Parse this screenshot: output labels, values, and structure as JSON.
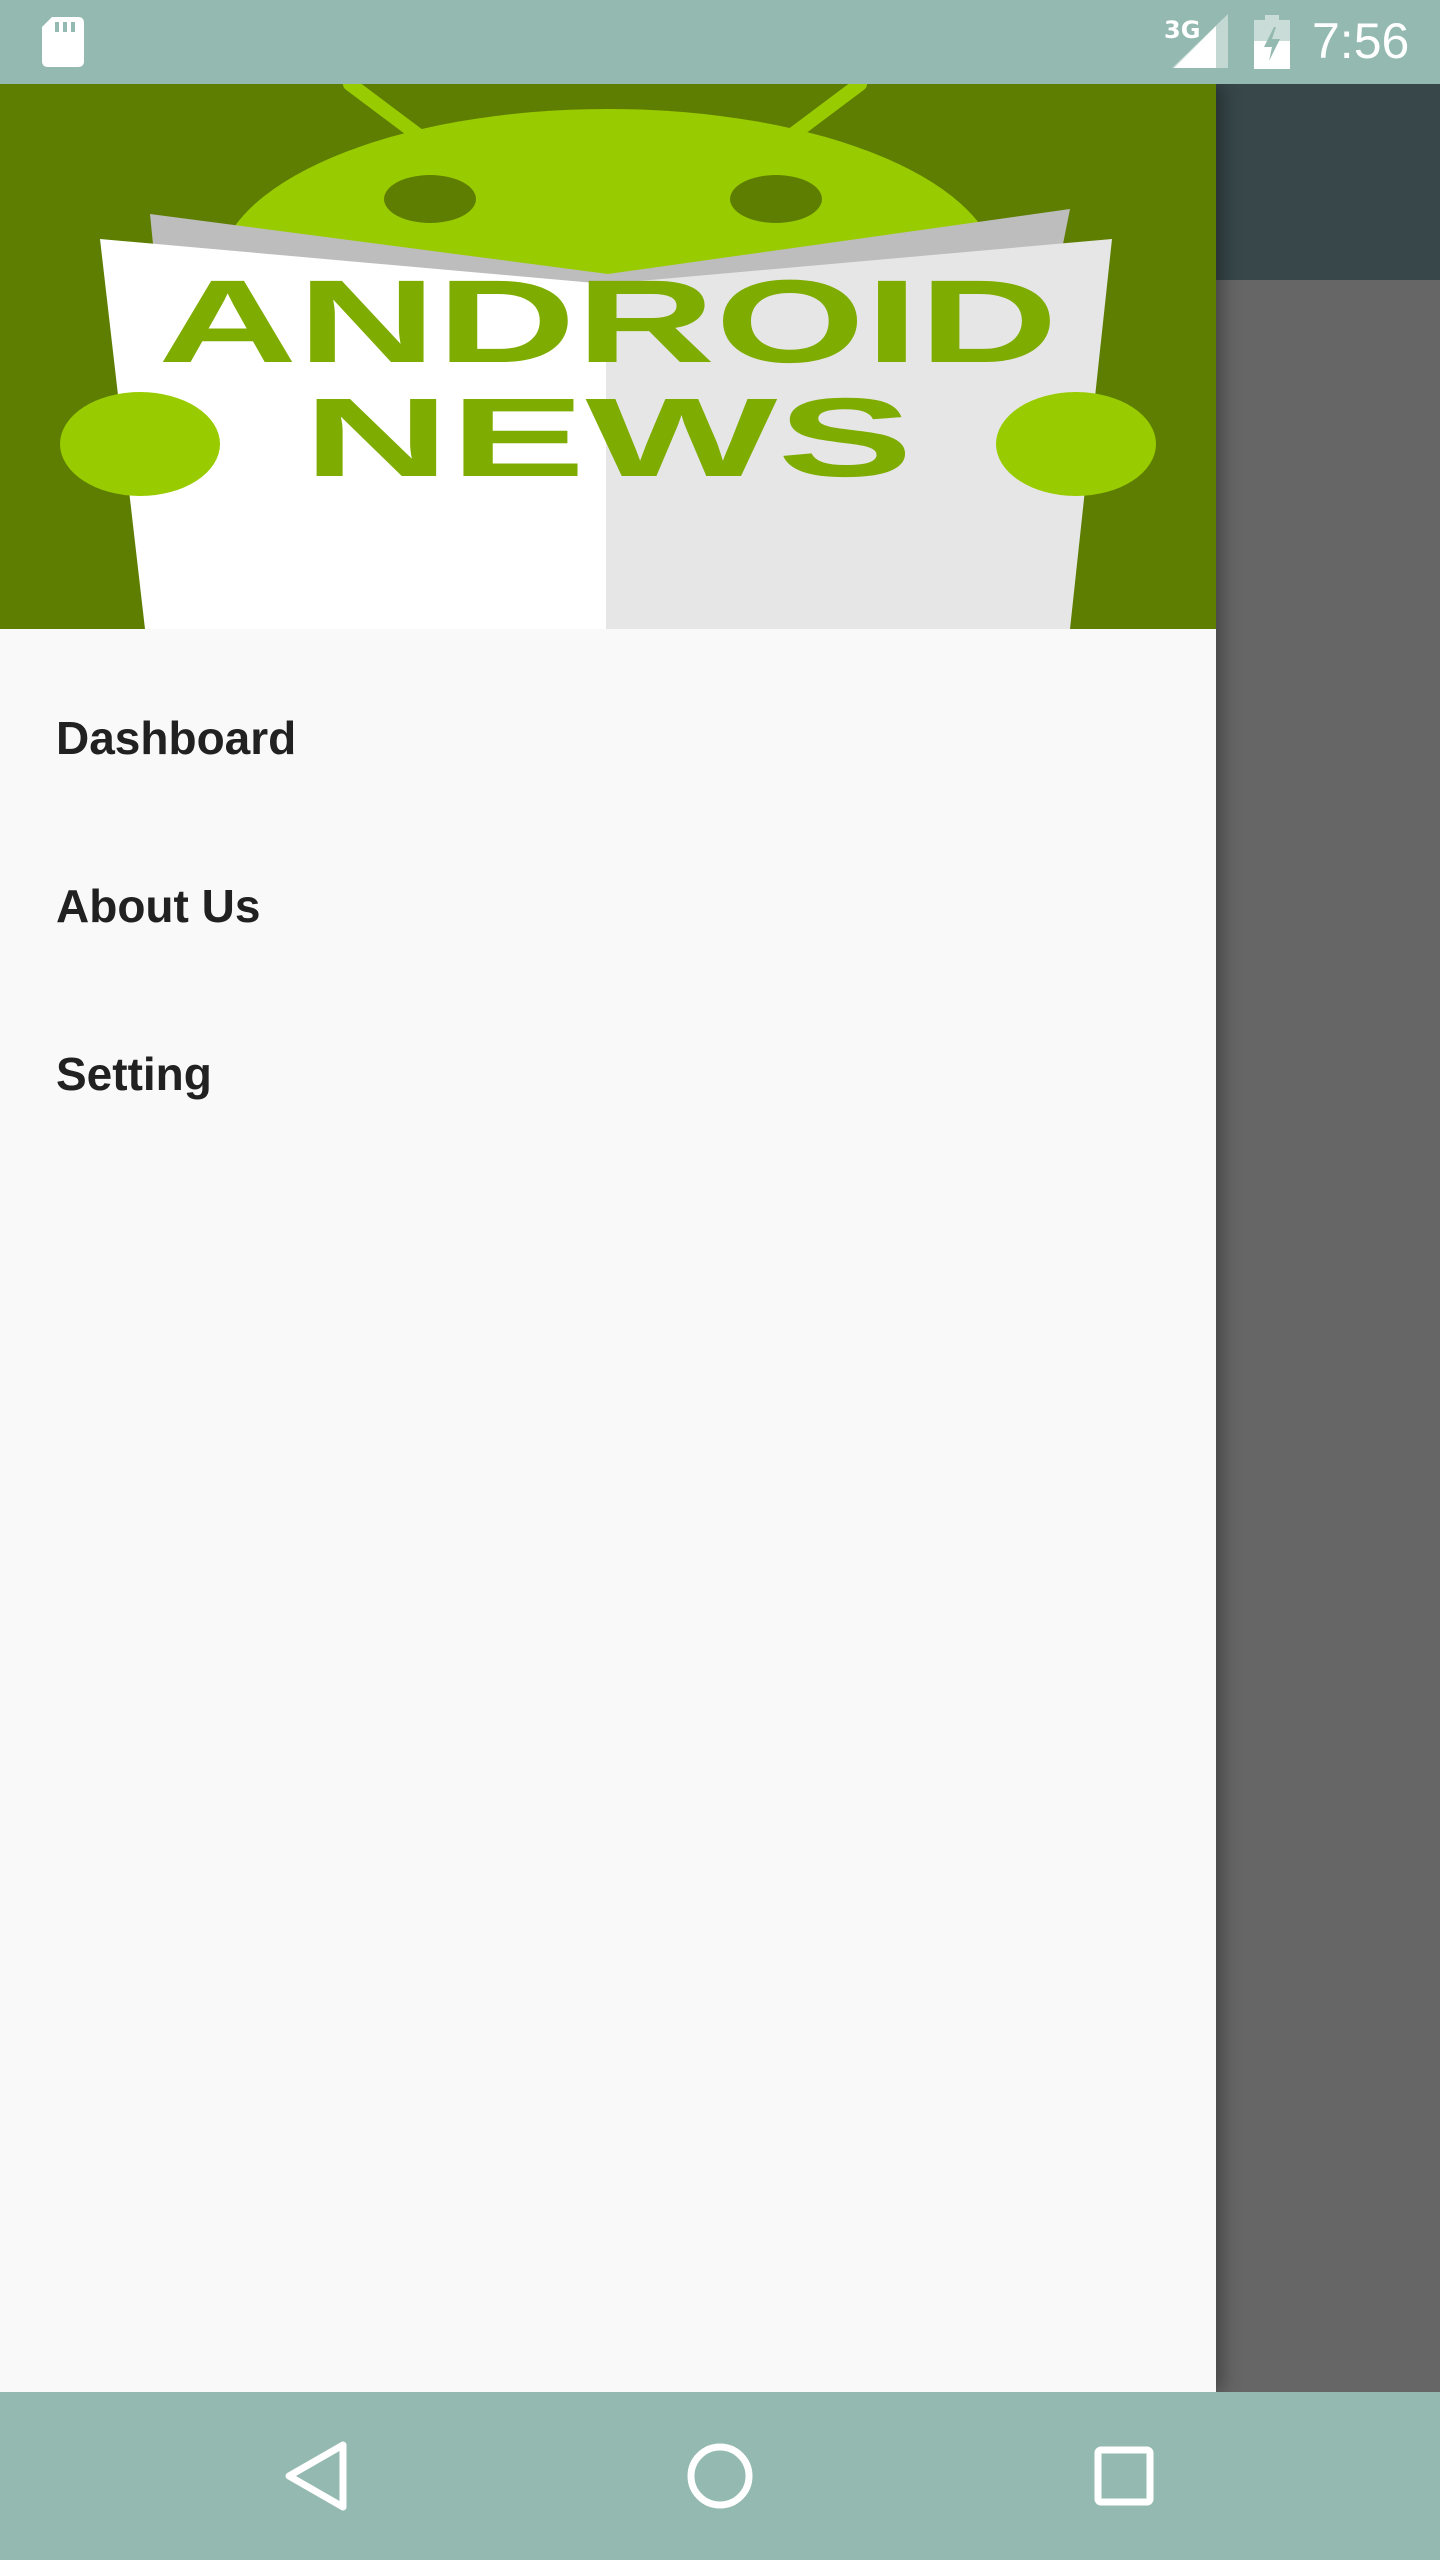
{
  "status_bar": {
    "network": "3G",
    "time": "7:56",
    "icons": [
      "sd-card-icon",
      "signal-icon",
      "battery-charging-icon"
    ]
  },
  "drawer": {
    "header_logo": {
      "line1": "ANDROID",
      "line2": "NEWS"
    },
    "menu_items": [
      {
        "label": "Dashboard"
      },
      {
        "label": "About Us"
      },
      {
        "label": "Setting"
      }
    ]
  },
  "nav_bar": {
    "icons": [
      "back-icon",
      "home-icon",
      "recents-icon"
    ]
  },
  "colors": {
    "status_bar": "#93b9b0",
    "header_bg": "#5e7e02",
    "android_green": "#99cc00",
    "logo_text": "#7fac00",
    "app_toolbar": "#37474a",
    "scrim": "#666666",
    "drawer_bg": "#f9f9f9"
  }
}
